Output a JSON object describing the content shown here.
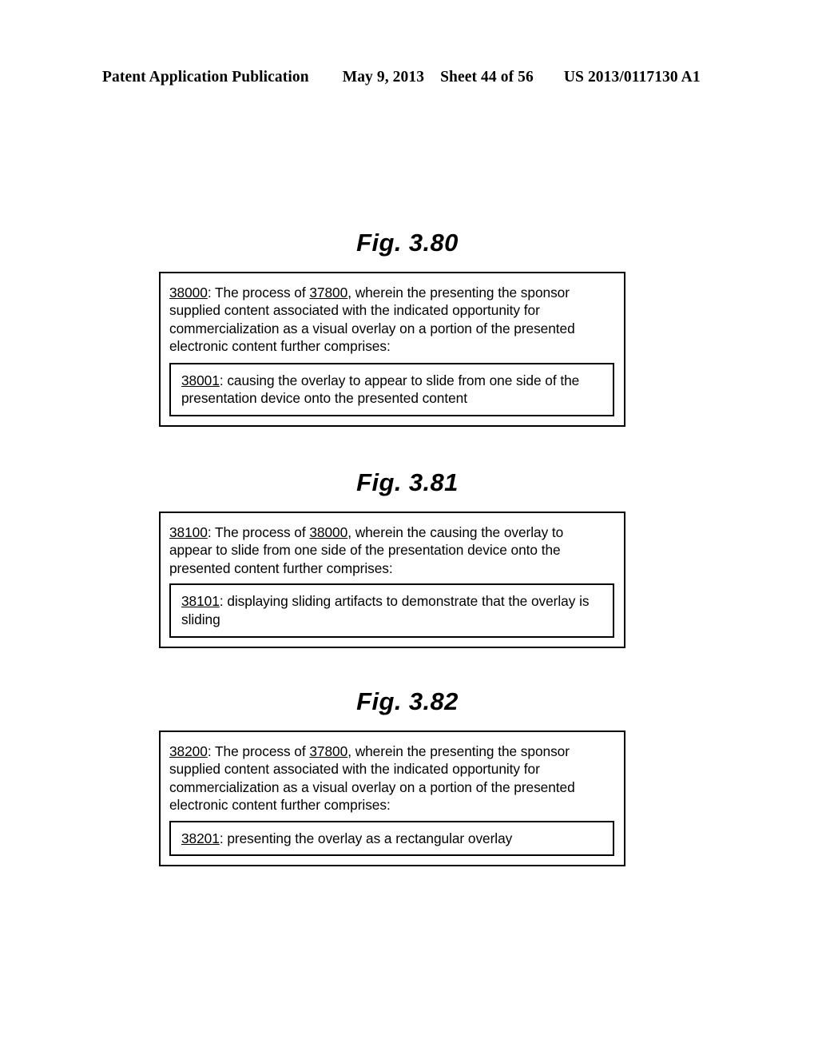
{
  "header": {
    "publication": "Patent Application Publication",
    "date": "May 9, 2013",
    "sheet": "Sheet 44 of 56",
    "patent_number": "US 2013/0117130 A1"
  },
  "figures": [
    {
      "title": "Fig. 3.80",
      "outer": {
        "ref": "38000",
        "colon": ":",
        "lead": " The process of ",
        "ref2": "37800",
        "body": ", wherein the presenting the sponsor supplied content associated with the indicated opportunity for commercialization as a visual overlay on a portion of the presented electronic content further comprises:"
      },
      "inner": {
        "ref": "38001",
        "colon": ":",
        "body": " causing the overlay to appear to slide from one side of the presentation device onto the presented content"
      }
    },
    {
      "title": "Fig. 3.81",
      "outer": {
        "ref": "38100",
        "colon": ":",
        "lead": " The process of ",
        "ref2": "38000",
        "body": ", wherein the causing the overlay to appear to slide from one side of the presentation device onto the presented content further comprises:"
      },
      "inner": {
        "ref": "38101",
        "colon": ":",
        "body": " displaying sliding artifacts to demonstrate that the overlay is sliding"
      }
    },
    {
      "title": "Fig. 3.82",
      "outer": {
        "ref": "38200",
        "colon": ":",
        "lead": " The process of ",
        "ref2": "37800",
        "body": ", wherein the presenting the sponsor supplied content associated with the indicated opportunity for commercialization as a visual overlay on a portion of the presented electronic content further comprises:"
      },
      "inner": {
        "ref": "38201",
        "colon": ":",
        "body": " presenting the overlay as a rectangular overlay"
      }
    }
  ]
}
